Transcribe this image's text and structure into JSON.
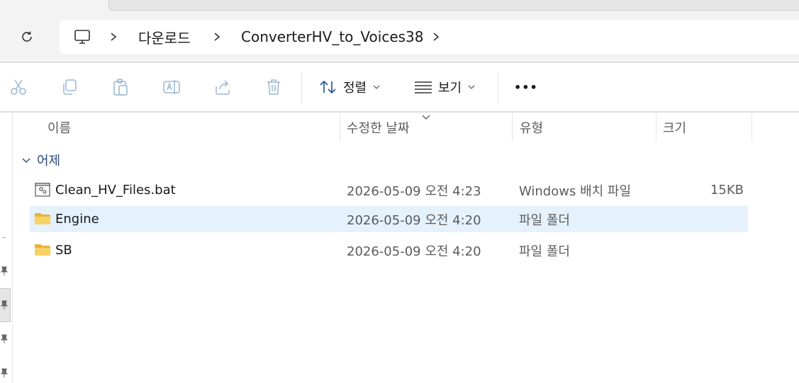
{
  "address_bar": {
    "computer_icon": "monitor-icon",
    "crumbs": [
      "다운로드",
      "ConverterHV_to_Voices38"
    ]
  },
  "toolbar": {
    "sort_label": "정렬",
    "view_label": "보기",
    "more_label": "•••"
  },
  "columns": {
    "name": "이름",
    "date": "수정한 날짜",
    "type": "유형",
    "size": "크기"
  },
  "group": {
    "label": "어제"
  },
  "files": [
    {
      "name": "Clean_HV_Files.bat",
      "date": "2026-05-09 오전 4:23",
      "type": "Windows 배치 파일",
      "size": "15KB",
      "icon": "batch-file-icon",
      "selected": false
    },
    {
      "name": "Engine",
      "date": "2026-05-09 오전 4:20",
      "type": "파일 폴더",
      "size": "",
      "icon": "folder-icon",
      "selected": true
    },
    {
      "name": "SB",
      "date": "2026-05-09 오전 4:20",
      "type": "파일 폴더",
      "size": "",
      "icon": "folder-icon",
      "selected": false
    }
  ],
  "colors": {
    "selection": "#e5f1fb",
    "folder": "#f4c542",
    "accent": "#2b4a7a"
  }
}
